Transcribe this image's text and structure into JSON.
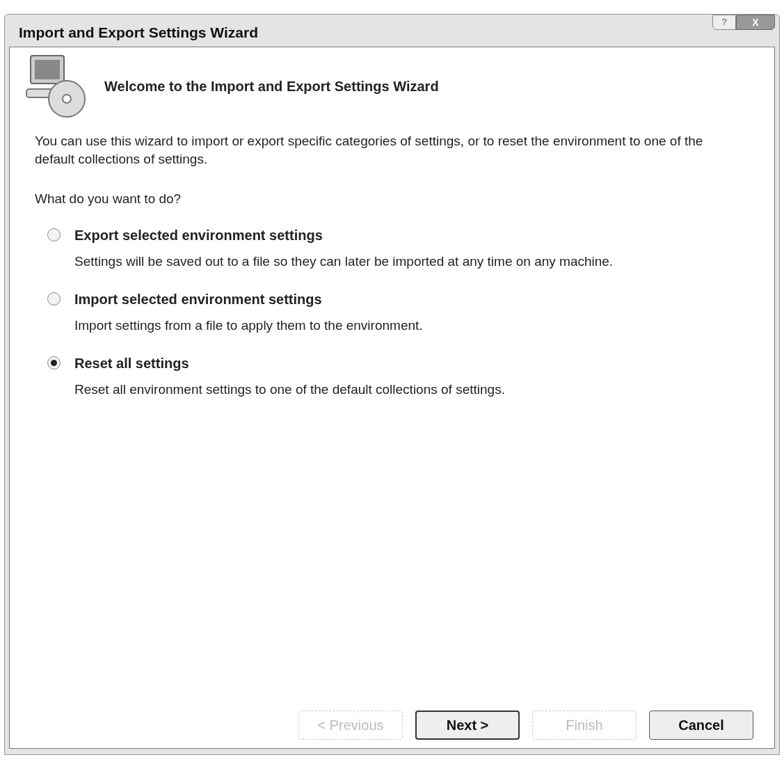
{
  "window": {
    "title": "Import and Export Settings Wizard"
  },
  "title_buttons": [
    {
      "kind": "help",
      "label": "?"
    },
    {
      "kind": "close",
      "label": "X"
    }
  ],
  "header": {
    "title": "Welcome to the Import and Export Settings Wizard"
  },
  "intro": "You can use this wizard to import or export specific categories of settings, or to reset the environment to one of the default collections of settings.",
  "question": "What do you want to do?",
  "options": [
    {
      "label": "Export selected environment settings",
      "description": "Settings will be saved out to a file so they can later be imported at any time on any machine.",
      "selected": false
    },
    {
      "label": "Import selected environment settings",
      "description": "Import settings from a file to apply them to the environment.",
      "selected": false
    },
    {
      "label": "Reset all settings",
      "description": "Reset all environment settings to one of the default collections of settings.",
      "selected": true
    }
  ],
  "buttons": [
    {
      "label": "< Previous",
      "disabled": true,
      "default": false
    },
    {
      "label": "Next >",
      "disabled": false,
      "default": true
    },
    {
      "label": "Finish",
      "disabled": true,
      "default": false
    },
    {
      "label": "Cancel",
      "disabled": false,
      "default": false
    }
  ]
}
